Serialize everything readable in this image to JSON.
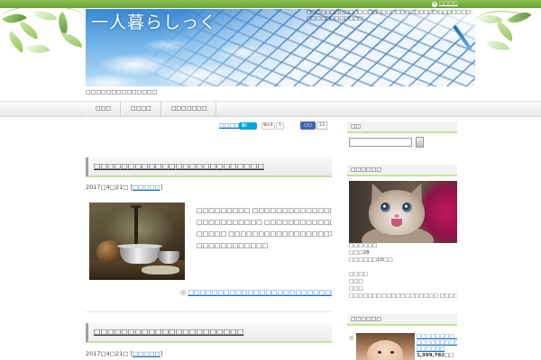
{
  "colors": {
    "accent_green": "#7cb342",
    "link_blue": "#1a6fc4",
    "heading_underline": "#c3e39b",
    "share_hatena": "#00a4de",
    "share_facebook": "#4267b2"
  },
  "icons": {
    "topbar_link": "arrow-circle-icon",
    "read_more": "◎",
    "ranking_bullet": "◎"
  },
  "topbar": {
    "link_label": "□□□□"
  },
  "header": {
    "logo": "一人暮らしっく",
    "description": "□□□□□□□□□□□□□□□□□□□□□□□□□□□□□□□□□□□□□□□□□□□□□□□",
    "tagline": "□□□□□□□□□□□□□□"
  },
  "nav": {
    "items": [
      "□□□",
      "□□□□",
      "□□□□□□□"
    ]
  },
  "share": {
    "link_label": "□□□□",
    "hatena_label": "B!",
    "gplus_label": "G+1",
    "gplus_count": "1",
    "facebook_label": "□□",
    "facebook_count": "23"
  },
  "posts": [
    {
      "title": "□□□□□□□□□□□□□□□□□□□□□□□□□",
      "date": "2017□4□21□",
      "category": "□□□□□",
      "excerpt_lines": [
        "□□□□□□□□□ □□□□□□□□□□□□□□□□□□",
        "□□□□□□□□□□□ □□□□□□□□□□□□□□□",
        "□□□□□ □□□□□□□□□□□□□□□□□100□",
        "□□□□□□□□□□□□"
      ],
      "read_more": "□□□□□□□□□□□□□□□□□□□□□□□□□□□□□"
    },
    {
      "title": "□□□□□□□□□□□□□□□□□□□□□□",
      "date": "2017□4□21□",
      "category": "□□□□□"
    }
  ],
  "sidebar": {
    "search": {
      "title": "□□"
    },
    "profile": {
      "title": "□□□□□□",
      "lines": [
        "□□□□□□",
        "□□□28",
        "□□□□□□10□□",
        "□□□□",
        "□□□",
        "□□□",
        "□□□□□□□□□□□□□□□□□□□ □□□□□□□□"
      ]
    },
    "ranking": {
      "title": "□□□□□□",
      "item_lines": [
        "□□□□□□□□…□",
        "□□□□□□□□□,□",
        "□□□□□□"
      ],
      "count": "1,399,782□□"
    }
  }
}
